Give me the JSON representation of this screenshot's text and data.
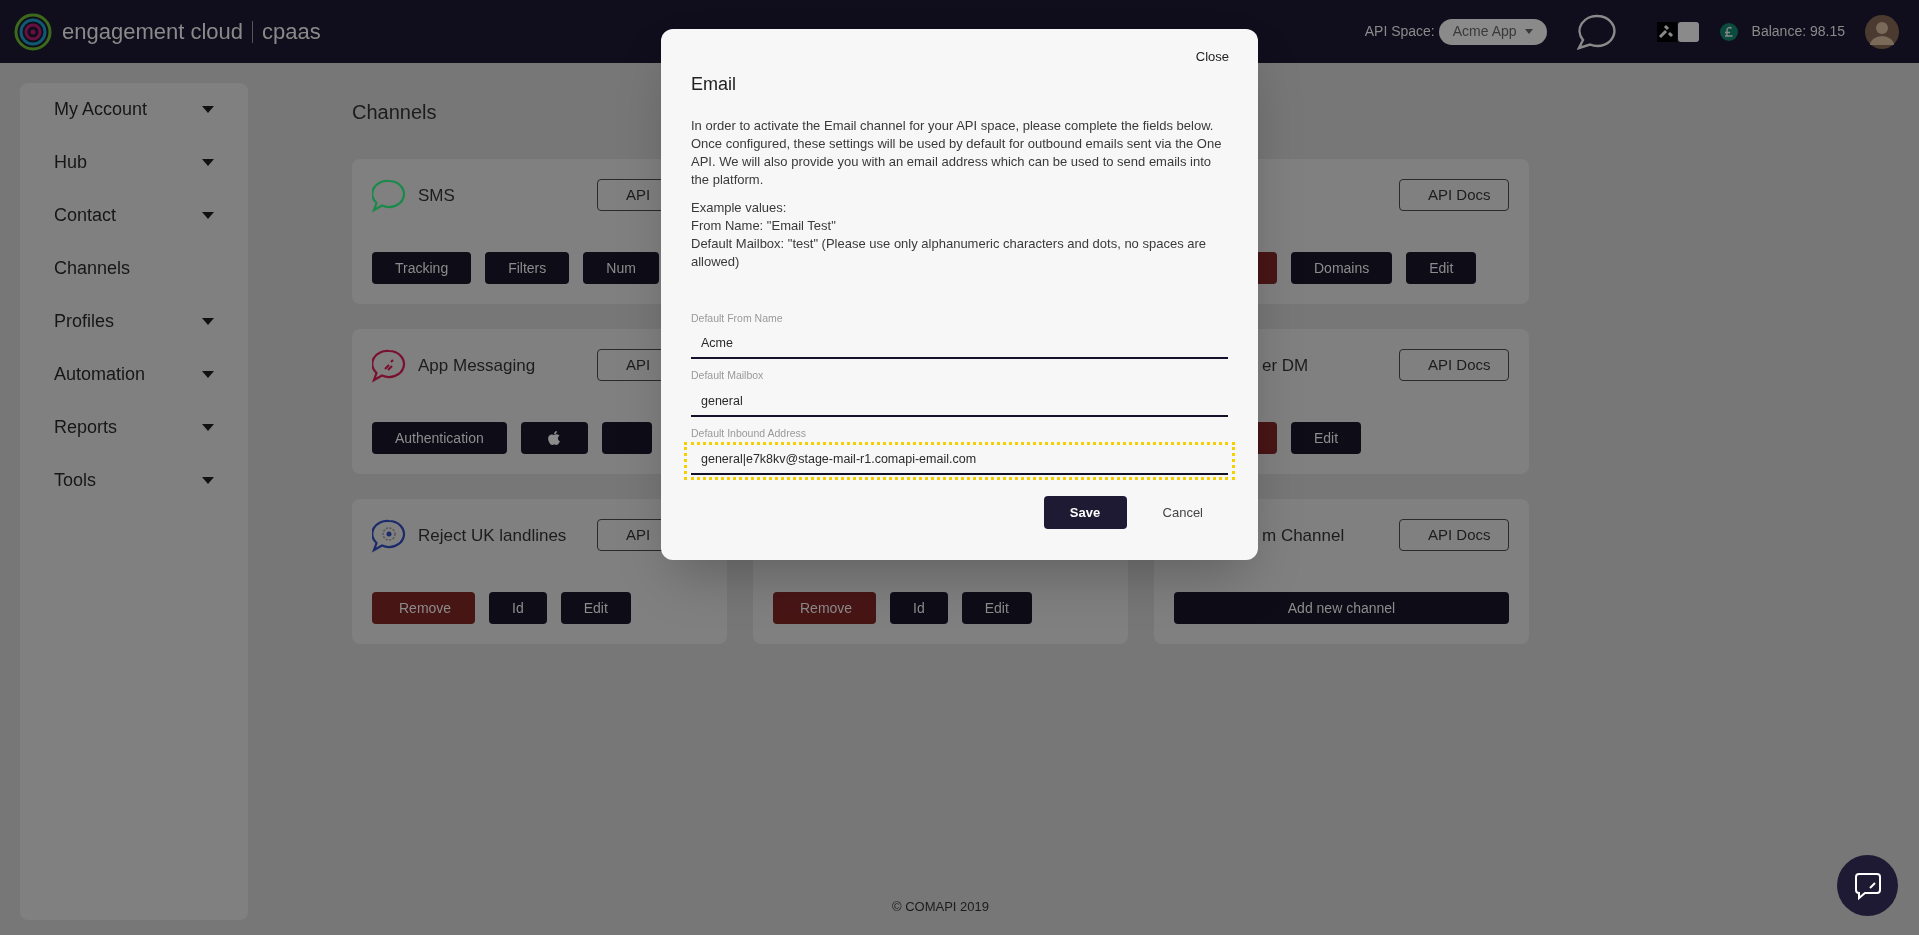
{
  "topbar": {
    "brand": "engagement cloud",
    "product": "cpaas",
    "api_space_label": "API Space:",
    "api_space_value": "Acme App",
    "balance": "Balance: 98.15"
  },
  "sidebar": {
    "items": [
      {
        "label": "My Account",
        "has_submenu": true
      },
      {
        "label": "Hub",
        "has_submenu": true
      },
      {
        "label": "Contact",
        "has_submenu": true
      },
      {
        "label": "Channels",
        "has_submenu": false
      },
      {
        "label": "Profiles",
        "has_submenu": true
      },
      {
        "label": "Automation",
        "has_submenu": true
      },
      {
        "label": "Reports",
        "has_submenu": true
      },
      {
        "label": "Tools",
        "has_submenu": true
      }
    ]
  },
  "page_title": "Channels",
  "columns": [
    [
      {
        "kind": "sms",
        "title": "SMS",
        "docs": "API",
        "buttons": [
          {
            "kind": "dark",
            "label": "Tracking"
          },
          {
            "kind": "dark",
            "label": "Filters"
          },
          {
            "kind": "dark",
            "label": "Num"
          }
        ]
      },
      {
        "kind": "app",
        "title": "App Messaging",
        "docs": "API",
        "buttons": [
          {
            "kind": "dark",
            "label": "Authentication"
          },
          {
            "kind": "apple"
          },
          {
            "kind": "dark"
          }
        ]
      },
      {
        "kind": "reject",
        "title": "Reject UK landlines",
        "docs": "API",
        "buttons": [
          {
            "kind": "remove",
            "label": "Remove"
          },
          {
            "kind": "dark",
            "label": "Id"
          },
          {
            "kind": "dark",
            "label": "Edit"
          }
        ]
      }
    ],
    [
      {
        "kind": "plain",
        "buttons": [
          {
            "kind": "remove",
            "label": "Remove"
          },
          {
            "kind": "dark",
            "label": "Id"
          },
          {
            "kind": "dark",
            "label": "Edit"
          }
        ]
      }
    ],
    [
      {
        "kind": "plain",
        "docs": "API Docs",
        "buttons": [
          {
            "kind": "remove"
          },
          {
            "kind": "dark",
            "label": "Domains"
          },
          {
            "kind": "dark",
            "label": "Edit"
          }
        ]
      },
      {
        "kind": "plain",
        "title": "er DM",
        "docs": "API Docs",
        "buttons": [
          {
            "kind": "remove"
          },
          {
            "kind": "dark",
            "label": "Edit"
          }
        ]
      },
      {
        "kind": "plain",
        "title": "m Channel",
        "docs": "API Docs",
        "buttons": [
          {
            "kind": "wide",
            "label": "Add new channel"
          }
        ]
      }
    ]
  ],
  "footer": "© COMAPI 2019",
  "modal": {
    "close": "Close",
    "title": "Email",
    "intro": "In order to activate the Email channel for your API space, please complete the fields below. Once configured, these settings will be used by default for outbound emails sent via the One API. We will also provide you with an email address which can be used to send emails into the platform.",
    "examples": [
      "Example values:",
      "From Name: \"Email Test\"",
      "Default Mailbox: \"test\" (Please use only alphanumeric characters and dots, no spaces are allowed)"
    ],
    "fields": [
      {
        "label": "Default From Name",
        "value": "Acme",
        "highlighted": false
      },
      {
        "label": "Default Mailbox",
        "value": "general",
        "highlighted": false
      },
      {
        "label": "Default Inbound Address",
        "value": "general|e7k8kv@stage-mail-r1.comapi-email.com",
        "highlighted": true
      }
    ],
    "save": "Save",
    "cancel": "Cancel"
  }
}
